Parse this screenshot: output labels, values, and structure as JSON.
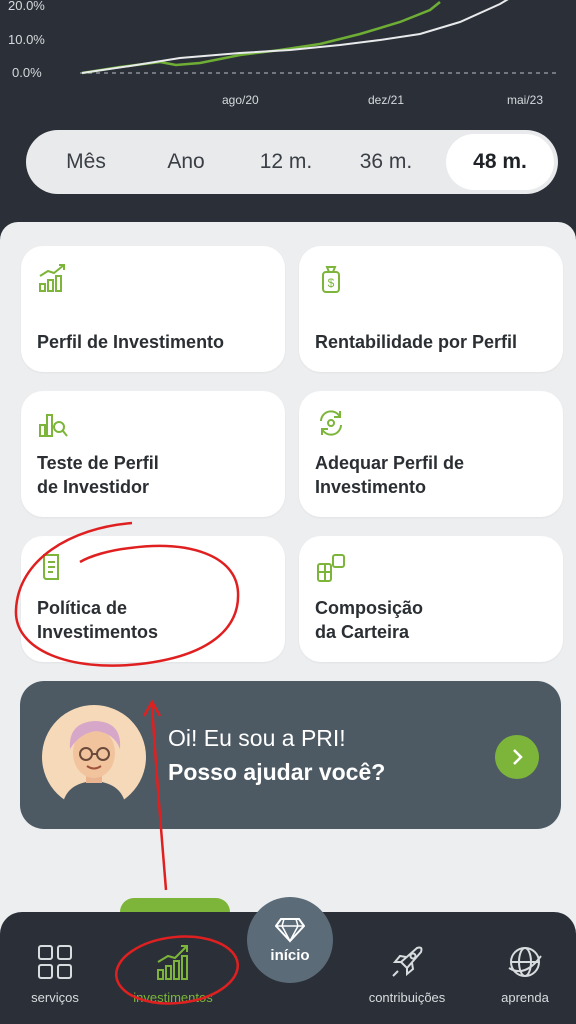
{
  "chart": {
    "y_ticks": [
      "20.0%",
      "10.0%",
      "0.0%"
    ],
    "x_ticks": [
      "ago/20",
      "dez/21",
      "mai/23"
    ],
    "colors": {
      "series_green": "#6fae35",
      "series_white": "#e8eaec",
      "baseline": "#8a9097"
    }
  },
  "period_selector": {
    "options": [
      "Mês",
      "Ano",
      "12 m.",
      "36 m.",
      "48 m."
    ],
    "selected": "48 m."
  },
  "cards": [
    {
      "label": "Perfil de Investimento",
      "icon": "growth-chart-icon"
    },
    {
      "label": "Rentabilidade por Perfil",
      "icon": "money-bag-icon"
    },
    {
      "label": "Teste de Perfil\nde Investidor",
      "icon": "chart-magnifier-icon"
    },
    {
      "label": "Adequar Perfil de\nInvestimento",
      "icon": "refresh-cycle-icon"
    },
    {
      "label": "Política de\nInvestimentos",
      "icon": "document-icon"
    },
    {
      "label": "Composição\nda Carteira",
      "icon": "portfolio-blocks-icon"
    }
  ],
  "pri": {
    "line1": "Oi! Eu sou a PRI!",
    "line2": "Posso ajudar você?"
  },
  "nav": {
    "items": [
      "serviços",
      "investimentos",
      "contribuições",
      "aprenda"
    ],
    "home": "início",
    "active": "investimentos"
  },
  "colors": {
    "accent_green": "#7cb53a",
    "dark_bg": "#2b3038",
    "banner_bg": "#4d5a64",
    "annotation_red": "#e02020"
  }
}
